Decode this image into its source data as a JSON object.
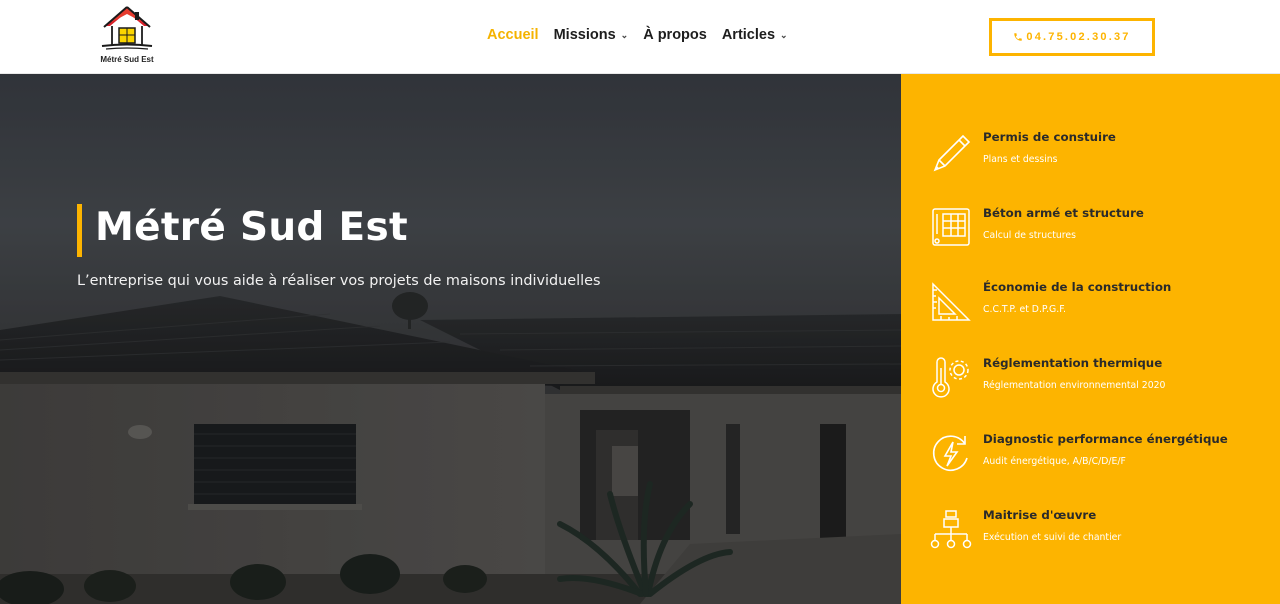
{
  "header": {
    "logo_text": "Métré Sud Est",
    "nav": [
      {
        "label": "Accueil",
        "active": true,
        "dropdown": false
      },
      {
        "label": "Missions",
        "active": false,
        "dropdown": true
      },
      {
        "label": "À propos",
        "active": false,
        "dropdown": false
      },
      {
        "label": "Articles",
        "active": false,
        "dropdown": true
      }
    ],
    "chevron": "⌄",
    "phone_icon": "phone-icon",
    "phone": "04.75.02.30.37"
  },
  "hero": {
    "title": "Métré Sud Est",
    "subtitle": "L’entreprise qui vous aide à réaliser vos projets de maisons individuelles"
  },
  "services": [
    {
      "title": "Permis de constuire",
      "subtitle": "Plans et dessins",
      "icon": "pencil-icon"
    },
    {
      "title": "Béton armé et structure",
      "subtitle": "Calcul de structures",
      "icon": "blueprint-icon"
    },
    {
      "title": "Économie de la construction",
      "subtitle": "C.C.T.P. et D.P.G.F.",
      "icon": "set-square-icon"
    },
    {
      "title": "Réglementation thermique",
      "subtitle": "Réglementation environnemental 2020",
      "icon": "thermometer-icon"
    },
    {
      "title": "Diagnostic performance énergétique",
      "subtitle": "Audit énergétique, A/B/C/D/E/F",
      "icon": "energy-icon"
    },
    {
      "title": "Maitrise d'œuvre",
      "subtitle": "Exécution et suivi de chantier",
      "icon": "hierarchy-icon"
    }
  ],
  "colors": {
    "accent": "#fdb400",
    "nav_active": "#f5b301",
    "text_dark": "#1d1d1d"
  }
}
